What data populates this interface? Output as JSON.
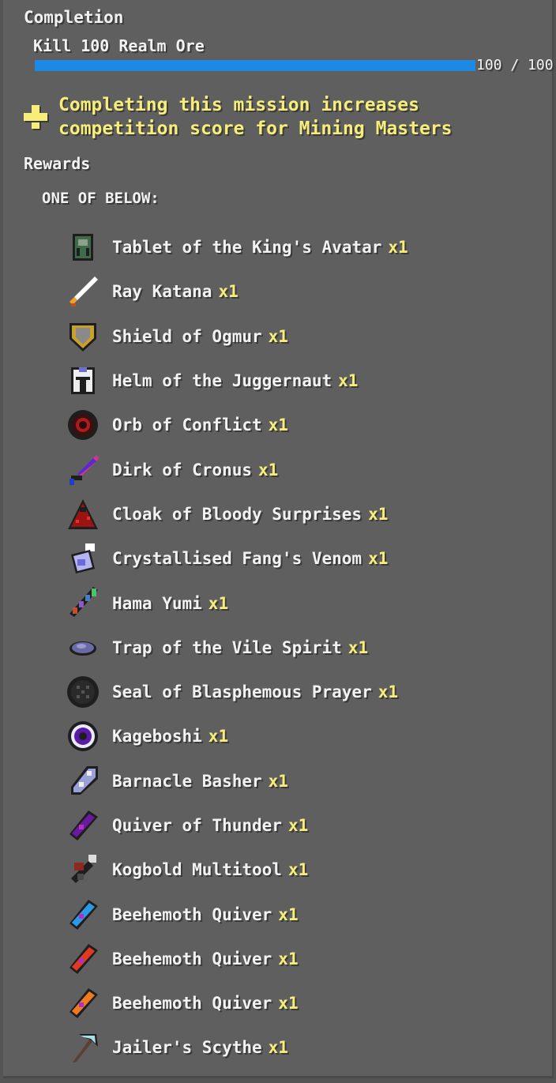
{
  "completion": {
    "heading": "Completion",
    "mission": "Kill 100 Realm Ore",
    "progress_text": "100 / 100",
    "progress_fraction": 1.0,
    "progress_color": "#1e88e5"
  },
  "notice": {
    "line1": "Completing this mission increases",
    "line2": "competition score for Mining Masters",
    "color": "#f7ee7a",
    "icon": "plus-icon"
  },
  "rewards": {
    "heading": "Rewards",
    "choice_label": "ONE OF BELOW:",
    "items": [
      {
        "name": "Tablet of the King's Avatar",
        "qty": "x1",
        "icon": "tablet-icon"
      },
      {
        "name": "Ray Katana",
        "qty": "x1",
        "icon": "katana-icon"
      },
      {
        "name": "Shield of Ogmur",
        "qty": "x1",
        "icon": "shield-icon"
      },
      {
        "name": "Helm of the Juggernaut",
        "qty": "x1",
        "icon": "helm-icon"
      },
      {
        "name": "Orb of Conflict",
        "qty": "x1",
        "icon": "orb-icon"
      },
      {
        "name": "Dirk of Cronus",
        "qty": "x1",
        "icon": "dagger-icon"
      },
      {
        "name": "Cloak of Bloody Surprises",
        "qty": "x1",
        "icon": "cloak-icon"
      },
      {
        "name": "Crystallised Fang's Venom",
        "qty": "x1",
        "icon": "potion-icon"
      },
      {
        "name": "Hama Yumi",
        "qty": "x1",
        "icon": "bow-icon"
      },
      {
        "name": "Trap of the Vile Spirit",
        "qty": "x1",
        "icon": "trap-icon"
      },
      {
        "name": "Seal of Blasphemous Prayer",
        "qty": "x1",
        "icon": "seal-icon"
      },
      {
        "name": "Kageboshi",
        "qty": "x1",
        "icon": "star-icon"
      },
      {
        "name": "Barnacle Basher",
        "qty": "x1",
        "icon": "mace-icon"
      },
      {
        "name": "Quiver of Thunder",
        "qty": "x1",
        "icon": "quiver-icon"
      },
      {
        "name": "Kogbold Multitool",
        "qty": "x1",
        "icon": "multitool-icon"
      },
      {
        "name": "Beehemoth Quiver",
        "qty": "x1",
        "icon": "quiver-icon"
      },
      {
        "name": "Beehemoth Quiver",
        "qty": "x1",
        "icon": "quiver-icon"
      },
      {
        "name": "Beehemoth Quiver",
        "qty": "x1",
        "icon": "quiver-icon"
      },
      {
        "name": "Jailer's Scythe",
        "qty": "x1",
        "icon": "scythe-icon"
      }
    ]
  }
}
